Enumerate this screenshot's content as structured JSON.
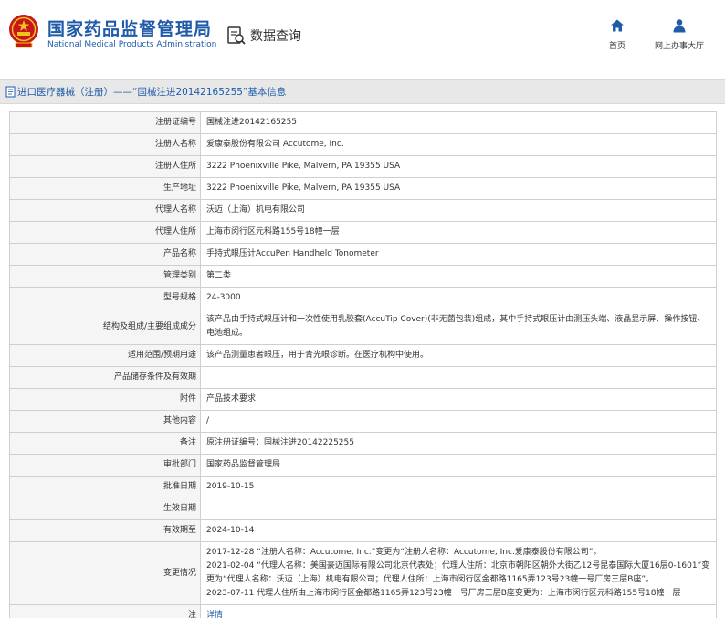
{
  "header": {
    "brand_cn": "国家药品监督管理局",
    "brand_en": "National Medical Products Administration",
    "data_query": "数据查询",
    "nav": {
      "home": "首页",
      "service_hall": "网上办事大厅"
    },
    "colors": {
      "brand_blue": "#1f5ba8",
      "emblem_red": "#c8161d",
      "emblem_gold": "#f0c419"
    }
  },
  "page": {
    "title": "进口医疗器械（注册）——“国械注进20142165255”基本信息"
  },
  "record": {
    "rows": [
      {
        "label": "注册证编号",
        "value": "国械注进20142165255"
      },
      {
        "label": "注册人名称",
        "value": "爱康泰股份有限公司 Accutome, Inc."
      },
      {
        "label": "注册人住所",
        "value": "3222 Phoenixville Pike, Malvern, PA 19355 USA"
      },
      {
        "label": "生产地址",
        "value": "3222 Phoenixville Pike, Malvern, PA 19355 USA"
      },
      {
        "label": "代理人名称",
        "value": "沃迈（上海）机电有限公司"
      },
      {
        "label": "代理人住所",
        "value": "上海市闵行区元科路155号18幢一层"
      },
      {
        "label": "产品名称",
        "value": "手持式眼压计AccuPen Handheld Tonometer"
      },
      {
        "label": "管理类别",
        "value": "第二类"
      },
      {
        "label": "型号规格",
        "value": "24-3000"
      },
      {
        "label": "结构及组成/主要组成成分",
        "value": "该产品由手持式眼压计和一次性使用乳胶套(AccuTip Cover)(非无菌包装)组成，其中手持式眼压计由测压头端、液晶显示屏、操作按钮、电池组成。"
      },
      {
        "label": "适用范围/预期用途",
        "value": "该产品测量患者眼压，用于青光眼诊断。在医疗机构中使用。"
      },
      {
        "label": "产品储存条件及有效期",
        "value": ""
      },
      {
        "label": "附件",
        "value": "产品技术要求"
      },
      {
        "label": "其他内容",
        "value": "/"
      },
      {
        "label": "备注",
        "value": "原注册证编号：国械注进20142225255"
      },
      {
        "label": "审批部门",
        "value": "国家药品监督管理局"
      },
      {
        "label": "批准日期",
        "value": "2019-10-15"
      },
      {
        "label": "生效日期",
        "value": ""
      },
      {
        "label": "有效期至",
        "value": "2024-10-14"
      }
    ],
    "history_label": "变更情况",
    "history": [
      "2017-12-28 “注册人名称：Accutome, Inc.”变更为“注册人名称：Accutome, Inc.爱康泰股份有限公司”。",
      "2021-02-04 “代理人名称：美国豪迈国际有限公司北京代表处；代理人住所：北京市朝阳区朝外大街乙12号昆泰国际大厦16层0-1601”变更为“代理人名称：沃迈（上海）机电有限公司；代理人住所：上海市闵行区金都路1165弄123号23幢一号厂房三层B座”。",
      "2023-07-11 代理人住所由上海市闵行区金都路1165弄123号23幢一号厂房三层B座变更为：上海市闵行区元科路155号18幢一层"
    ],
    "note_label": "注",
    "note_link": "详情"
  }
}
